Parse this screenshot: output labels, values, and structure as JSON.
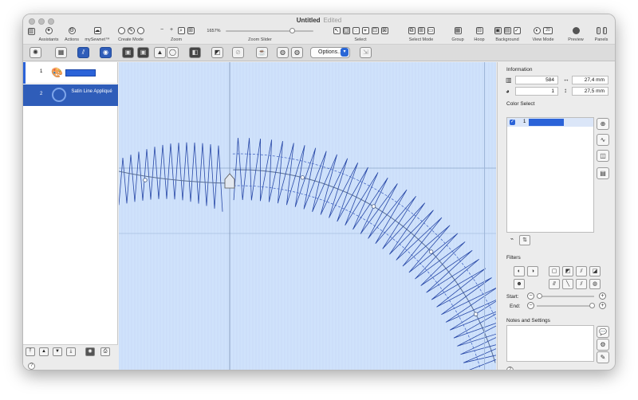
{
  "window": {
    "title": "Untitled",
    "status": "Edited"
  },
  "toolbar": {
    "assistants": "Assistants",
    "actions": "Actions",
    "mysewnet": "mySewnet™",
    "create_mode": "Create Mode",
    "zoom": "Zoom",
    "zoom_value": "1657%",
    "zoom_slider": "Zoom Slider",
    "select": "Select",
    "select_mode": "Select Mode",
    "group": "Group",
    "hoop": "Hoop",
    "background": "Background",
    "view_mode": "View Mode",
    "view_mode_num": "20",
    "preview": "Preview",
    "panels": "Panels",
    "zoom_slider_level": 0.78
  },
  "toolbar2": {
    "options_label": "Options..."
  },
  "objects": [
    {
      "index": "1",
      "type": "palette"
    },
    {
      "index": "2",
      "name": "Satin Line Appliqué",
      "selected": true
    }
  ],
  "right": {
    "information_title": "Information",
    "stitches": "584",
    "width": "27,4 mm",
    "colors": "1",
    "height": "27,5 mm",
    "color_select_title": "Color Select",
    "color_rows": [
      {
        "num": "1",
        "color": "#2b63d8",
        "checked": true
      }
    ],
    "filters_title": "Filters",
    "start_label": "Start:",
    "end_label": "End:",
    "notes_title": "Notes and Settings"
  },
  "icons": {
    "help": "?"
  }
}
